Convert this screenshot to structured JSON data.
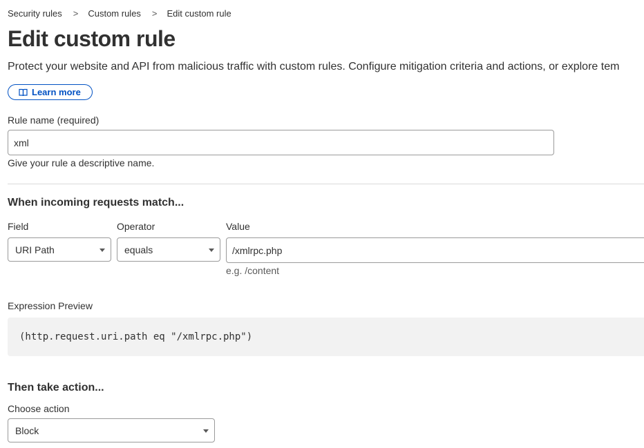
{
  "breadcrumb": {
    "items": [
      "Security rules",
      "Custom rules"
    ],
    "current": "Edit custom rule",
    "separator": ">"
  },
  "page": {
    "title": "Edit custom rule",
    "subtitle": "Protect your website and API from malicious traffic with custom rules. Configure mitigation criteria and actions, or explore tem",
    "learn_more_label": "Learn more",
    "learn_more_icon": "book-icon",
    "accent_color": "#0051c3"
  },
  "rule_name": {
    "label": "Rule name (required)",
    "value": "xml",
    "hint": "Give your rule a descriptive name."
  },
  "match": {
    "section_title": "When incoming requests match...",
    "field_label": "Field",
    "field_value": "URI Path",
    "operator_label": "Operator",
    "operator_value": "equals",
    "value_label": "Value",
    "value_value": "/xmlrpc.php",
    "value_hint": "e.g. /content"
  },
  "expression": {
    "label": "Expression Preview",
    "text": "(http.request.uri.path eq \"/xmlrpc.php\")"
  },
  "action": {
    "section_title": "Then take action...",
    "label": "Choose action",
    "value": "Block"
  }
}
